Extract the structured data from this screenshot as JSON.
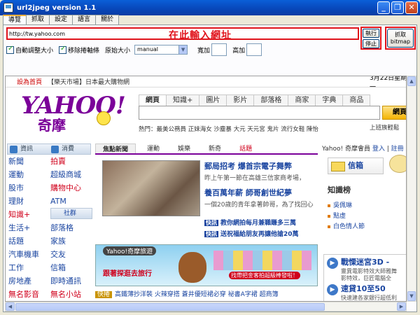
{
  "window": {
    "title": "url2jpeg version 1.1",
    "minimize_glyph": "_",
    "maximize_glyph": "❐",
    "close_glyph": "✕"
  },
  "tabs": [
    "導覽",
    "抓取",
    "設定",
    "語言",
    "關於"
  ],
  "active_tab": "導覽",
  "url": {
    "value": "http://tw.yahoo.com",
    "hint": "在此輸入網址"
  },
  "options": {
    "auto_adjust_label": "自動調整大小",
    "remove_scrollbar_label": "移除捲軸條",
    "original_size_label": "原始大小",
    "size_select_value": "manual",
    "width_label": "寬加",
    "height_label": "高加"
  },
  "buttons": {
    "go": "執行",
    "stop": "停止",
    "capture_line1": "抓取",
    "capture_line2": "bitmap"
  },
  "scroll_glyphs": {
    "up": "▲",
    "down": "▼",
    "left": "◀",
    "right": "▶"
  },
  "yahoo": {
    "top_home": "設為首頁",
    "top_market": "【樂天市場】日本最大購物網",
    "top_date": "3月22日星期一",
    "logo": "YAHOO!",
    "logo_sub": "奇摩",
    "search_tabs": [
      "網頁",
      "知識+",
      "圖片",
      "影片",
      "部落格",
      "商家",
      "字典",
      "商品"
    ],
    "search_button": "網頁",
    "hot": "熱門：最美公務員 正妹海女 沙塵暴 大元 天元宮 鬼片 流行女鞋 陳怡",
    "hot_right": "上班族輕鬆",
    "left_header1": "資訊",
    "left_header2": "消費",
    "left_sub": "社群",
    "left_links": [
      {
        "a": "新聞",
        "b": "拍賣",
        "a_red": false,
        "b_red": true
      },
      {
        "a": "運動",
        "b": "超級商城",
        "a_red": false,
        "b_red": false
      },
      {
        "a": "股市",
        "b": "購物中心",
        "a_red": false,
        "b_red": true
      },
      {
        "a": "理財",
        "b": "ATM",
        "a_red": false,
        "b_red": false
      },
      {
        "a": "知識+",
        "b": "",
        "a_red": true,
        "b_red": false
      },
      {
        "a": "生活+",
        "b": "部落格",
        "a_red": false,
        "b_red": false
      },
      {
        "a": "話題",
        "b": "家族",
        "a_red": false,
        "b_red": false
      },
      {
        "a": "汽車機車",
        "b": "交友",
        "a_red": false,
        "b_red": false
      },
      {
        "a": "工作",
        "b": "信箱",
        "a_red": false,
        "b_red": false
      },
      {
        "a": "房地產",
        "b": "即時通訊",
        "a_red": false,
        "b_red": false
      },
      {
        "a": "無名影音",
        "b": "無名小站",
        "a_red": true,
        "b_red": true
      }
    ],
    "news_tabs": [
      "焦點新聞",
      "運動",
      "娛樂",
      "新奇",
      "話題"
    ],
    "headline1": "郵局招考 爆首宗電子舞弊",
    "desc1": "昨上午第一節在高雄三信家商考場，",
    "headline2": "養百萬年薪 師哥創世紀夢",
    "desc2": "一個20歲的青年拿著帥哥，為了找回心",
    "flash_tag": "快訊",
    "flash1": "教你網拍每月兼職賺多三萬",
    "flash2": "送祝福給朋友再讓他搶20萬",
    "banner_title": "Yahoo!奇摩旅遊",
    "banner_caption": "跟著探逛去旅行",
    "banner_btn": "找帶把金客拍超級棒發啦！",
    "ticker_tag": "快捲",
    "ticker": "高鐵薄抄洋裝  火辣穿搭  蒼井優短裙必穿  祕書A字裙  超商簿",
    "right_top": "Yahoo! 奇摩會員",
    "right_login": "登入",
    "right_reg": "註冊",
    "mail": "信箱",
    "knowledge": "知識榜",
    "know_links": [
      "吳佩琳",
      "點虛",
      "白色情人節"
    ],
    "promo1_title": "戰慄迷宮3D -",
    "promo1_desc": "靈異電影特效大師雅舞",
    "promo1_desc2": "影特效，巨匠電腦全",
    "promo2_title": "速貸10至50",
    "promo2_desc": "快速建各家銀行超低利"
  }
}
